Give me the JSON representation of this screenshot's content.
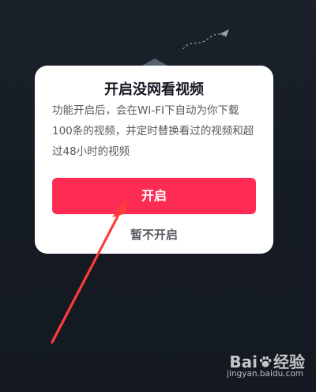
{
  "dialog": {
    "title": "开启没网看视频",
    "description": "功能开启后，会在WI-FI下自动为你下载100条的视频，并定时替换看过的视频和超过48小时的视频",
    "primary_button_label": "开启",
    "secondary_button_label": "暂不开启"
  },
  "watermark": {
    "logo_text_left": "Bai",
    "logo_text_right": "经验",
    "url": "jingyan.baidu.com"
  },
  "colors": {
    "background": "#161c24",
    "primary": "#fe2c55",
    "annotation_arrow": "#ff3b3b"
  },
  "icons": [
    "paper-plane-icon",
    "paw-icon"
  ]
}
